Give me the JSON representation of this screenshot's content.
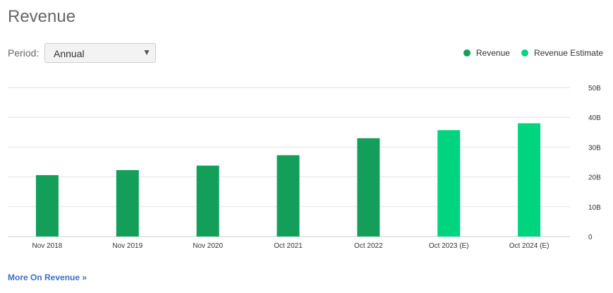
{
  "header": {
    "title": "Revenue"
  },
  "period": {
    "label": "Period:",
    "selected": "Annual",
    "arrow_icon": "triangle-down-icon"
  },
  "legend": {
    "items": [
      {
        "label": "Revenue",
        "color": "#139e5a"
      },
      {
        "label": "Revenue Estimate",
        "color": "#00d47f"
      }
    ]
  },
  "footer": {
    "more_link": "More On Revenue »"
  },
  "chart_data": {
    "type": "bar",
    "title": "",
    "xlabel": "",
    "ylabel": "",
    "ylim": [
      0,
      50
    ],
    "y_ticks": [
      0,
      10,
      20,
      30,
      40,
      50
    ],
    "y_tick_labels": [
      "0",
      "10B",
      "20B",
      "30B",
      "40B",
      "50B"
    ],
    "grid": true,
    "legend_position": "top-right",
    "categories": [
      "Nov 2018",
      "Nov 2019",
      "Nov 2020",
      "Oct 2021",
      "Oct 2022",
      "Oct 2023 (E)",
      "Oct 2024 (E)"
    ],
    "series": [
      {
        "name": "Revenue",
        "color": "#139e5a",
        "values": [
          20.6,
          22.3,
          23.8,
          27.3,
          33.0,
          null,
          null
        ]
      },
      {
        "name": "Revenue Estimate",
        "color": "#00d47f",
        "values": [
          null,
          null,
          null,
          null,
          null,
          35.7,
          38.0
        ]
      }
    ]
  }
}
